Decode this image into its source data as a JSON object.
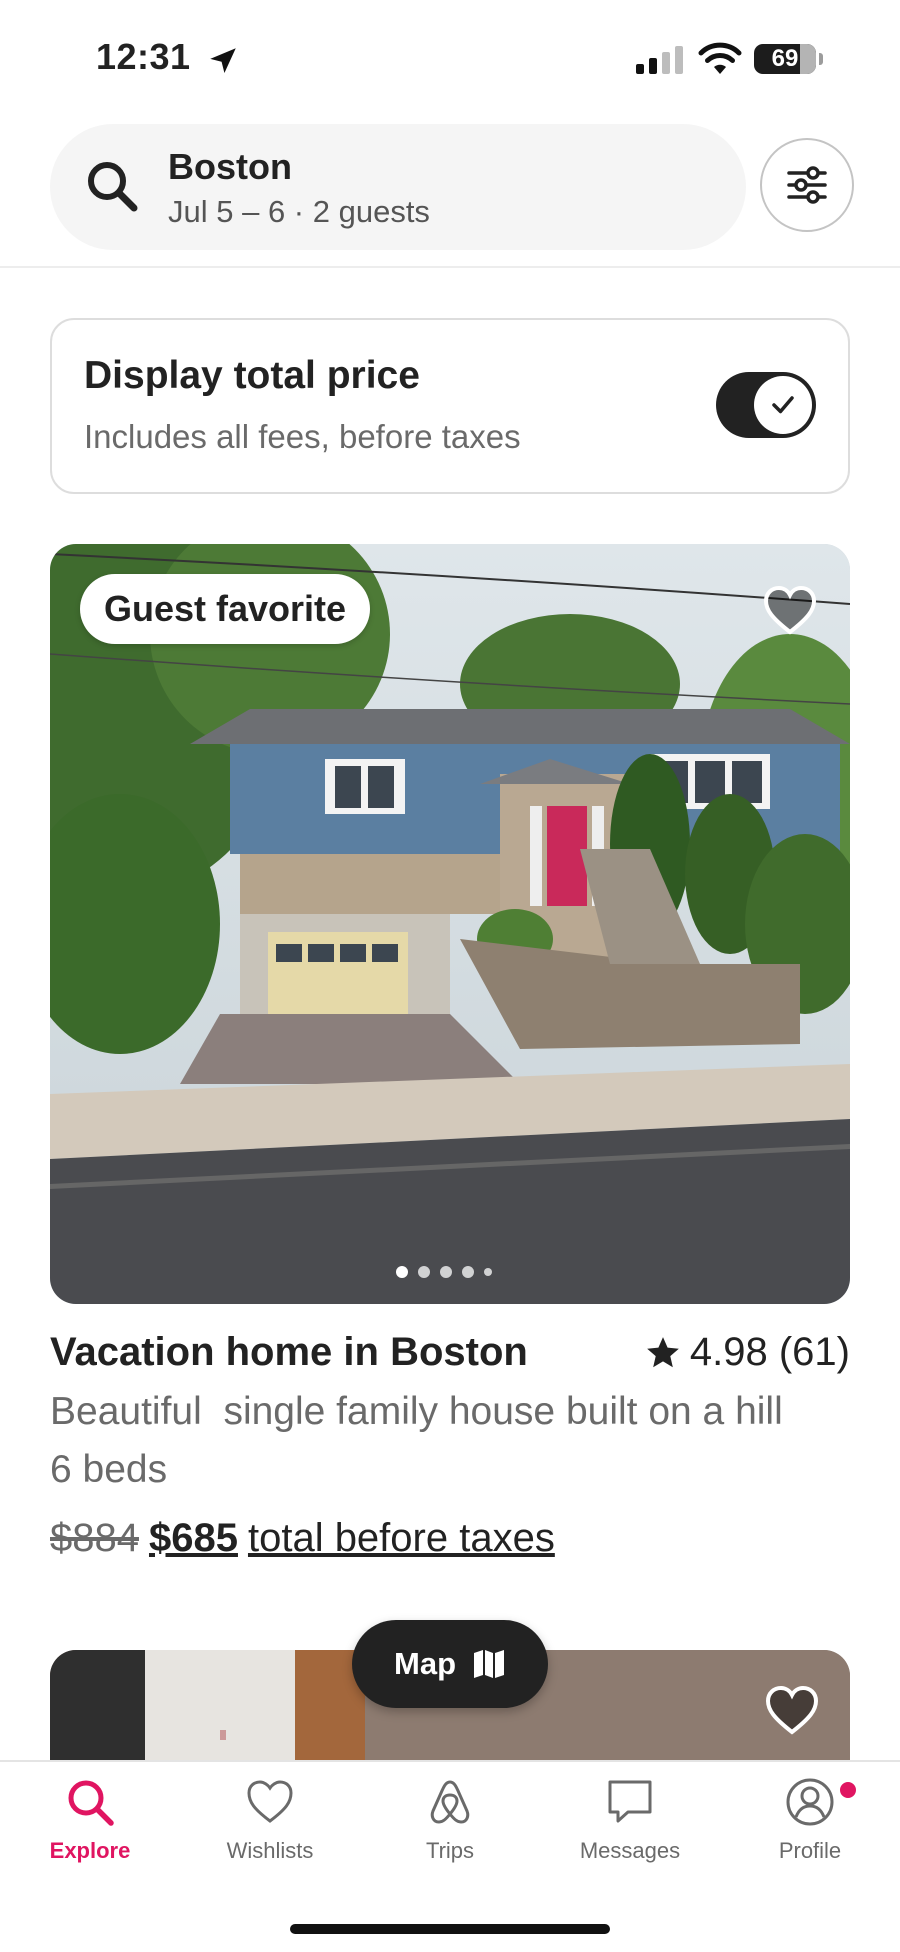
{
  "status_bar": {
    "time": "12:31",
    "battery": "69"
  },
  "search": {
    "city": "Boston",
    "details": "Jul 5 – 6 · 2 guests"
  },
  "price_toggle": {
    "title": "Display total price",
    "subtitle": "Includes all fees, before taxes",
    "enabled": true
  },
  "listings": [
    {
      "badge": "Guest favorite",
      "title": "Vacation home in Boston",
      "rating": "4.98 (61)",
      "description": "Beautiful  single family house built on a hill",
      "beds": "6 beds",
      "old_price": "$884",
      "price": "$685",
      "price_suffix": "total before taxes",
      "photo_count": 5,
      "current_photo": 1
    }
  ],
  "map_button": {
    "label": "Map"
  },
  "tabs": [
    {
      "label": "Explore",
      "icon": "search-icon",
      "active": true
    },
    {
      "label": "Wishlists",
      "icon": "heart-icon",
      "active": false
    },
    {
      "label": "Trips",
      "icon": "airbnb-logo-icon",
      "active": false
    },
    {
      "label": "Messages",
      "icon": "message-icon",
      "active": false
    },
    {
      "label": "Profile",
      "icon": "profile-icon",
      "active": false
    }
  ],
  "colors": {
    "accent": "#E01561",
    "text": "#222222",
    "muted": "#6A6A6A"
  }
}
